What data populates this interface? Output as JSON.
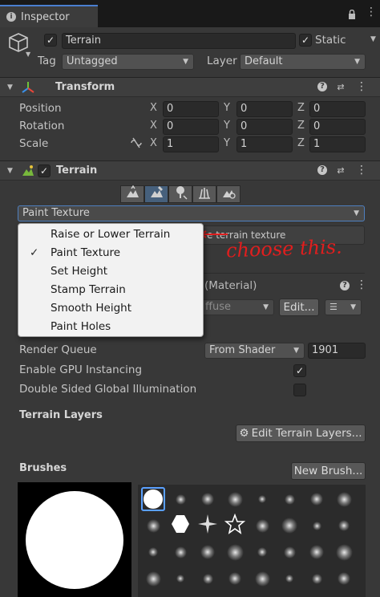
{
  "window": {
    "tab_title": "Inspector"
  },
  "object": {
    "name": "Terrain",
    "active": true,
    "static_label": "Static",
    "static_checked": true,
    "tag_label": "Tag",
    "tag_value": "Untagged",
    "layer_label": "Layer",
    "layer_value": "Default"
  },
  "transform": {
    "title": "Transform",
    "rows": [
      {
        "label": "Position",
        "x": "0",
        "y": "0",
        "z": "0"
      },
      {
        "label": "Rotation",
        "x": "0",
        "y": "0",
        "z": "0"
      },
      {
        "label": "Scale",
        "x": "1",
        "y": "1",
        "z": "1"
      }
    ],
    "axis": {
      "x": "X",
      "y": "Y",
      "z": "Z"
    }
  },
  "terrain": {
    "title": "Terrain",
    "enabled": true,
    "tool_icons": [
      "raise-terrain-icon",
      "paint-terrain-icon",
      "paint-trees-icon",
      "paint-details-icon",
      "terrain-settings-icon"
    ],
    "selected_tool": 1,
    "mode_value": "Paint Texture",
    "help_partial": "e terrain texture",
    "material_partial": "(Material)",
    "shader_partial": "ffuse",
    "edit_label": "Edit...",
    "render_queue_label": "Render Queue",
    "render_queue_mode": "From Shader",
    "render_queue_value": "1901",
    "gpu_instancing_label": "Enable GPU Instancing",
    "gpu_instancing_checked": true,
    "double_sided_label": "Double Sided Global Illumination",
    "double_sided_checked": false,
    "layers_title": "Terrain Layers",
    "edit_layers_label": "Edit Terrain Layers...",
    "brushes_title": "Brushes",
    "new_brush_label": "New Brush..."
  },
  "dropdown_menu": {
    "items": [
      "Raise or Lower Terrain",
      "Paint Texture",
      "Set Height",
      "Stamp Terrain",
      "Smooth Height",
      "Paint Holes"
    ],
    "checked_index": 1
  },
  "annotation": {
    "text": "choose this.",
    "color": "#e01e1e"
  }
}
